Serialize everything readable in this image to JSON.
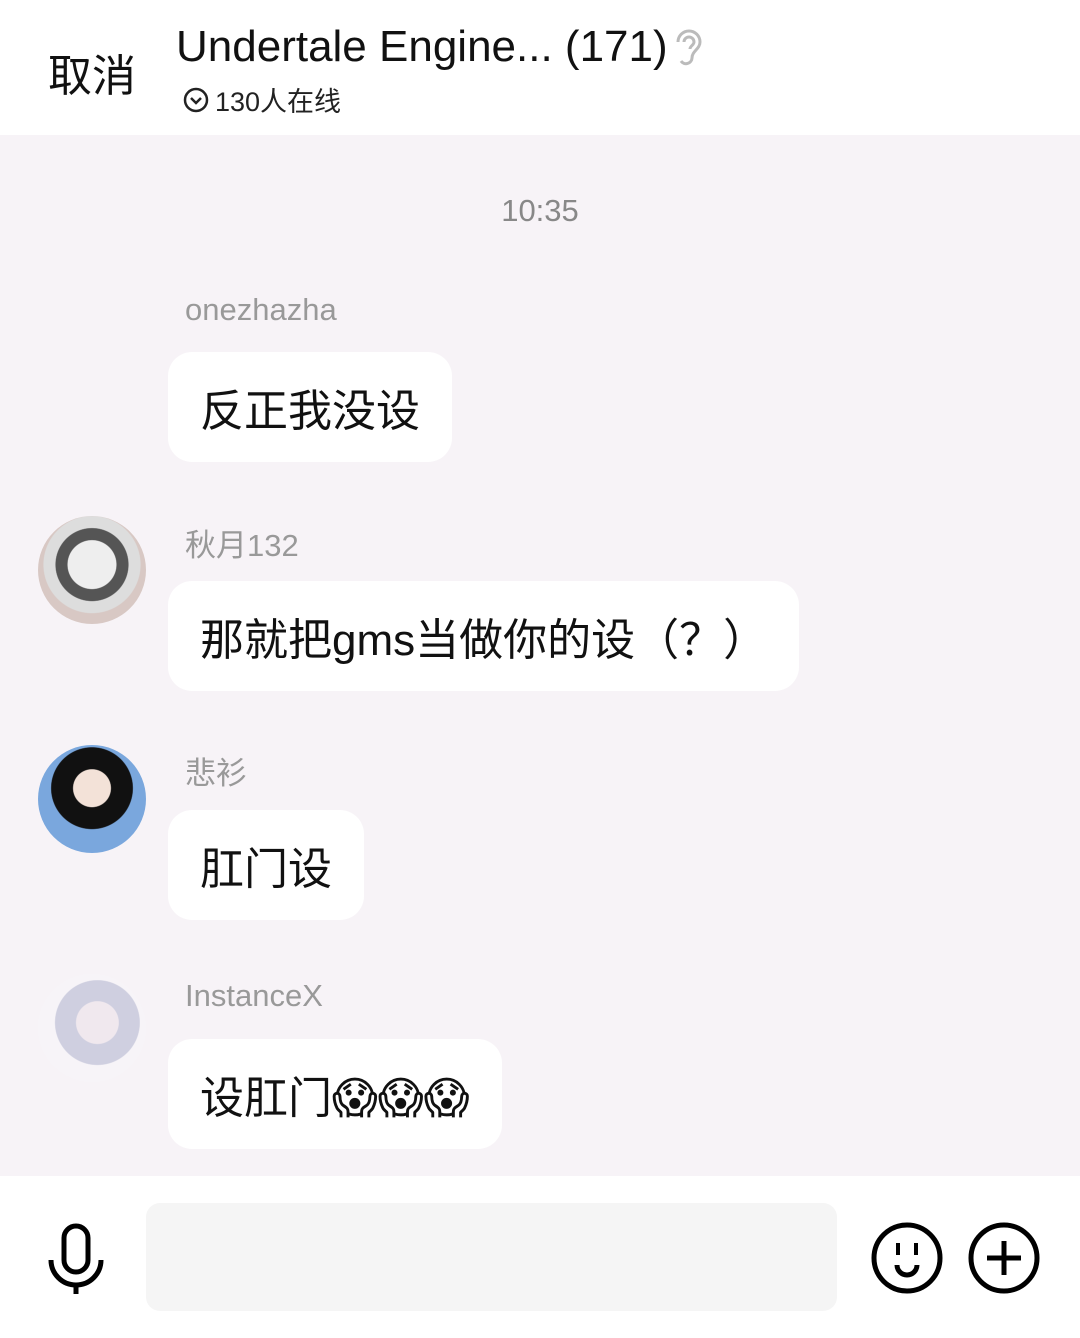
{
  "header": {
    "cancel_label": "取消",
    "title": "Undertale Engine... (171)",
    "online": "130人在线"
  },
  "chat": {
    "timestamp": "10:35",
    "messages": [
      {
        "sender": "onezhazha",
        "text": "反正我没设",
        "avatar": false
      },
      {
        "sender": "秋月132",
        "text": "那就把gms当做你的设（？）",
        "avatar": true
      },
      {
        "sender": "悲衫",
        "text": "肛门设",
        "avatar": true
      },
      {
        "sender": "InstanceX",
        "text": "设肛门😱😱😱",
        "avatar": true
      }
    ]
  },
  "footer": {
    "input_value": ""
  }
}
